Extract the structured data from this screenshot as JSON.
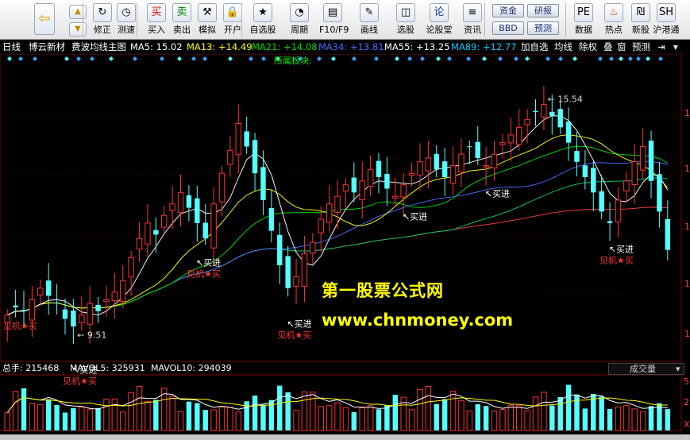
{
  "toolbar": {
    "buttons": [
      {
        "id": "back",
        "label": "",
        "icon": "back-arrow-icon",
        "glyph": "⇦"
      },
      {
        "id": "pageup",
        "label": "",
        "icon": "page-up-icon",
        "glyph": "▲"
      },
      {
        "id": "pagedown",
        "label": "",
        "icon": "page-down-icon",
        "glyph": "▼"
      },
      {
        "id": "fix",
        "label": "修正",
        "icon": "recalc-icon",
        "glyph": "↻"
      },
      {
        "id": "speed",
        "label": "测速",
        "icon": "stopwatch-icon",
        "glyph": "◷"
      },
      {
        "id": "buy",
        "label": "买入",
        "icon": "buy-icon",
        "glyph": "买"
      },
      {
        "id": "sell",
        "label": "卖出",
        "icon": "sell-icon",
        "glyph": "卖"
      },
      {
        "id": "simulate",
        "label": "模拟",
        "icon": "hammer-icon",
        "glyph": "⚒"
      },
      {
        "id": "open",
        "label": "开户",
        "icon": "lock-icon",
        "glyph": "🔒"
      },
      {
        "id": "selfselect",
        "label": "自选股",
        "icon": "star-list-icon",
        "glyph": "★"
      },
      {
        "id": "period",
        "label": "周期",
        "icon": "clock-icon",
        "glyph": "◔"
      },
      {
        "id": "f10",
        "label": "F10/F9",
        "icon": "f10-icon",
        "glyph": "▤"
      },
      {
        "id": "draw",
        "label": "画线",
        "icon": "pencil-icon",
        "glyph": "✎"
      },
      {
        "id": "pick",
        "label": "选股",
        "icon": "stock-pick-icon",
        "glyph": "◫"
      },
      {
        "id": "forum",
        "label": "论股堂",
        "icon": "forum-icon",
        "glyph": "论"
      },
      {
        "id": "news",
        "label": "资讯",
        "icon": "news-icon",
        "glyph": "≡"
      },
      {
        "id": "data",
        "label": "数据",
        "icon": "pe-icon",
        "glyph": "PE"
      },
      {
        "id": "hot",
        "label": "热点",
        "icon": "fire-icon",
        "glyph": "♨"
      },
      {
        "id": "newstock",
        "label": "新股",
        "icon": "ipo-icon",
        "glyph": "₪"
      },
      {
        "id": "hkconnect",
        "label": "沪港通",
        "icon": "sse-hke-icon",
        "glyph": "SH"
      }
    ],
    "small_buttons": [
      "资金",
      "BBD",
      "研报",
      "预测"
    ]
  },
  "infobar": {
    "period": "日线",
    "stock_name": "博云新材",
    "indicator": "费波均线主图",
    "ma5": "MA5: 15.02",
    "ma13": "MA13: +14.49",
    "ma21": "MA21: +14.08",
    "ma34": "MA34: +13.81",
    "ma55": "MA55: +13.25",
    "ma89": "MA89: +12.77",
    "add_favorite": "加自选",
    "ma_line": "均线",
    "adjust": "除权",
    "overlay": "叠",
    "window": "窗",
    "forecast": "预测"
  },
  "colors": {
    "up": "#ff3333",
    "down": "#54ffff",
    "ma5": "#ffffff",
    "ma13": "#ffff00",
    "ma21": "#00dd00",
    "ma34": "#4a6cff",
    "ma55": "#00cc66",
    "ma89": "#ff3a3a",
    "signal_buy": "#ffffff",
    "signal_warn": "#ff3333",
    "watermark": "#ffff00"
  },
  "chart": {
    "sector_label": "所属板块:",
    "high_label": "15.54",
    "low_label": "9.51",
    "buy_label": "买进",
    "warn_label": "见机★买",
    "right_axis_labels": [
      "1",
      "1",
      "1",
      "1",
      "1"
    ]
  },
  "chart_data": {
    "type": "candlestick",
    "close": [
      9.9,
      10.1,
      10.0,
      10.3,
      10.6,
      10.4,
      10.2,
      9.8,
      9.6,
      9.9,
      10.2,
      10.0,
      10.3,
      10.5,
      10.8,
      11.4,
      11.9,
      12.3,
      12.0,
      12.5,
      12.8,
      13.1,
      12.7,
      12.3,
      11.9,
      12.8,
      13.6,
      14.2,
      14.9,
      14.3,
      13.6,
      12.9,
      12.1,
      11.2,
      10.6,
      10.9,
      11.5,
      11.8,
      12.4,
      12.8,
      13.0,
      13.3,
      13.1,
      13.4,
      13.7,
      13.5,
      13.2,
      13.0,
      13.3,
      13.6,
      13.9,
      14.0,
      13.7,
      13.5,
      13.8,
      14.1,
      14.3,
      14.0,
      13.8,
      14.1,
      14.4,
      14.6,
      14.8,
      15.0,
      15.2,
      15.4,
      15.1,
      14.8,
      14.4,
      13.9,
      13.5,
      13.1,
      12.6,
      12.3,
      12.9,
      13.4,
      13.9,
      14.3,
      13.4,
      12.6,
      11.6
    ],
    "high_value": 15.54,
    "low_value": 9.51
  },
  "volume": {
    "total_label": "总手: 215468",
    "mavol5": "MAVOL5: 325931",
    "mavol10": "MAVOL10: 294039",
    "dropdown": "成交量",
    "axis_labels": [
      "5",
      "2",
      "X"
    ]
  },
  "watermark": {
    "line1": "第一股票公式网",
    "line2": "www.chnmoney.com"
  }
}
